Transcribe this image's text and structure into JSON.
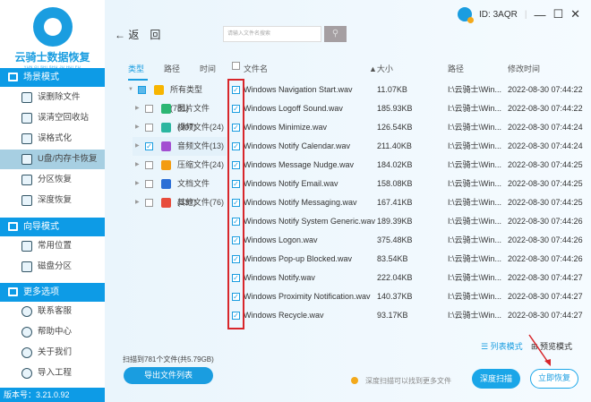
{
  "app": {
    "title": "云骑士数据恢复",
    "subtitle": "YUN QI SHI SHU JU HUI FU",
    "version": "版本号：3.21.0.92",
    "user_id": "ID: 3AQR"
  },
  "sidebar": {
    "sections": [
      {
        "label": "场景模式",
        "items": [
          "误删除文件",
          "误清空回收站",
          "误格式化",
          "U盘/内存卡恢复",
          "分区恢复",
          "深度恢复"
        ]
      },
      {
        "label": "向导模式",
        "items": [
          "常用位置",
          "磁盘分区"
        ]
      },
      {
        "label": "更多选项",
        "items": [
          "联系客服",
          "帮助中心",
          "关于我们",
          "导入工程"
        ]
      }
    ],
    "active": "U盘/内存卡恢复"
  },
  "toolbar": {
    "back": "← 返　回",
    "search_placeholder": "请输入文件名搜索",
    "search_icon": "search-icon"
  },
  "filter": {
    "tabs": [
      "类型",
      "路径",
      "时间"
    ],
    "tree": [
      {
        "label": "所有类型(781)",
        "color": "#f7b500"
      },
      {
        "label": "图片文件(307)",
        "color": "#2bb673"
      },
      {
        "label": "视频文件(24)",
        "color": "#2bb6a0"
      },
      {
        "label": "音频文件(13)",
        "color": "#a34fd1"
      },
      {
        "label": "压缩文件(24)",
        "color": "#f39c12"
      },
      {
        "label": "文档文件(337)",
        "color": "#2b6fd6"
      },
      {
        "label": "其他文件(76)",
        "color": "#e74c3c"
      }
    ]
  },
  "table": {
    "headers": {
      "name": "文件名",
      "size": "▲大小",
      "path": "路径",
      "time": "修改时间"
    },
    "rows": [
      {
        "name": "Windows Navigation Start.wav",
        "size": "11.07KB",
        "path": "I:\\云骑士\\Win...",
        "time": "2022-08-30 07:44:22"
      },
      {
        "name": "Windows Logoff Sound.wav",
        "size": "185.93KB",
        "path": "I:\\云骑士\\Win...",
        "time": "2022-08-30 07:44:22"
      },
      {
        "name": "Windows Minimize.wav",
        "size": "126.54KB",
        "path": "I:\\云骑士\\Win...",
        "time": "2022-08-30 07:44:24"
      },
      {
        "name": "Windows Notify Calendar.wav",
        "size": "211.40KB",
        "path": "I:\\云骑士\\Win...",
        "time": "2022-08-30 07:44:24"
      },
      {
        "name": "Windows Message Nudge.wav",
        "size": "184.02KB",
        "path": "I:\\云骑士\\Win...",
        "time": "2022-08-30 07:44:25"
      },
      {
        "name": "Windows Notify Email.wav",
        "size": "158.08KB",
        "path": "I:\\云骑士\\Win...",
        "time": "2022-08-30 07:44:25"
      },
      {
        "name": "Windows Notify Messaging.wav",
        "size": "167.41KB",
        "path": "I:\\云骑士\\Win...",
        "time": "2022-08-30 07:44:25"
      },
      {
        "name": "Windows Notify System Generic.wav",
        "size": "189.39KB",
        "path": "I:\\云骑士\\Win...",
        "time": "2022-08-30 07:44:26"
      },
      {
        "name": "Windows Logon.wav",
        "size": "375.48KB",
        "path": "I:\\云骑士\\Win...",
        "time": "2022-08-30 07:44:26"
      },
      {
        "name": "Windows Pop-up Blocked.wav",
        "size": "83.54KB",
        "path": "I:\\云骑士\\Win...",
        "time": "2022-08-30 07:44:26"
      },
      {
        "name": "Windows Notify.wav",
        "size": "222.04KB",
        "path": "I:\\云骑士\\Win...",
        "time": "2022-08-30 07:44:27"
      },
      {
        "name": "Windows Proximity Notification.wav",
        "size": "140.37KB",
        "path": "I:\\云骑士\\Win...",
        "time": "2022-08-30 07:44:27"
      },
      {
        "name": "Windows Recycle.wav",
        "size": "93.17KB",
        "path": "I:\\云骑士\\Win...",
        "time": "2022-08-30 07:44:27"
      }
    ]
  },
  "footer": {
    "count": "扫描到781个文件(共5.79GB)",
    "export": "导出文件列表",
    "tip": "深度扫描可以找到更多文件",
    "deep_scan": "深度扫描",
    "recover": "立即恢复",
    "list_mode": "列表模式",
    "preview_mode": "预览模式"
  }
}
